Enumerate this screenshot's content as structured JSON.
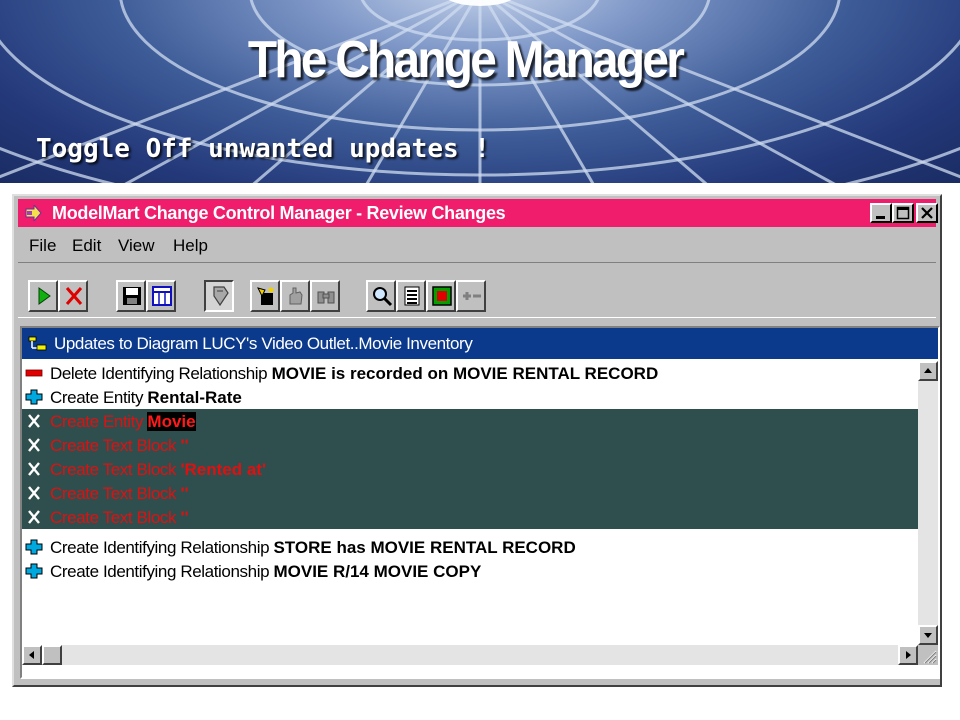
{
  "slide": {
    "title": "The Change Manager",
    "subtitle": "Toggle Off unwanted updates !"
  },
  "window": {
    "title": "ModelMart Change Control Manager - Review Changes",
    "controls": [
      "minimize",
      "maximize",
      "close"
    ]
  },
  "menu": [
    "File",
    "Edit",
    "View",
    "Help"
  ],
  "toolbar": {
    "buttons": [
      {
        "name": "run-button",
        "icon": "green-play-triangle"
      },
      {
        "name": "cancel-button",
        "icon": "red-x"
      },
      {
        "name": "save-button",
        "icon": "floppy-disk"
      },
      {
        "name": "grid-button",
        "icon": "grid"
      },
      {
        "name": "toggle-button",
        "icon": "toggle-pressed",
        "pressed": true
      },
      {
        "name": "select-all-button",
        "icon": "hand-select"
      },
      {
        "name": "filter-button",
        "icon": "hand-gray"
      },
      {
        "name": "find-button",
        "icon": "binoculars"
      },
      {
        "name": "search-button",
        "icon": "magnifier"
      },
      {
        "name": "list-button",
        "icon": "lines"
      },
      {
        "name": "entity-button",
        "icon": "green-box"
      },
      {
        "name": "expand-collapse-button",
        "icon": "plus-minus"
      }
    ]
  },
  "pane": {
    "header": "Updates to Diagram LUCY's Video Outlet..Movie Inventory"
  },
  "changes": [
    {
      "action": "Delete Identifying Relationship",
      "object": "MOVIE is recorded on MOVIE RENTAL RECORD",
      "status": "delete",
      "icon": "minus-icon"
    },
    {
      "action": "Create Entity",
      "object": "Rental-Rate",
      "status": "create",
      "icon": "plus-icon"
    },
    {
      "action": "Create Entity",
      "object": "Movie",
      "status": "off",
      "icon": "toggle-off-x-icon",
      "highlight": true
    },
    {
      "action": "Create Text Block",
      "object": "''",
      "status": "off",
      "icon": "toggle-off-x-icon"
    },
    {
      "action": "Create Text Block",
      "object": "'Rented at'",
      "status": "off",
      "icon": "toggle-off-x-icon"
    },
    {
      "action": "Create Text Block",
      "object": "''",
      "status": "off",
      "icon": "toggle-off-x-icon"
    },
    {
      "action": "Create Text Block",
      "object": "''",
      "status": "off",
      "icon": "toggle-off-x-icon"
    },
    {
      "action": "Create Identifying Relationship",
      "object": "STORE has MOVIE RENTAL RECORD",
      "status": "create",
      "icon": "plus-icon"
    },
    {
      "action": "Create Identifying Relationship",
      "object": "MOVIE R/14 MOVIE COPY",
      "status": "create",
      "icon": "plus-icon"
    }
  ],
  "colors": {
    "titlebar": "#ef1d6b",
    "pane_header": "#0b3a8c",
    "off_row_bg": "#2f4f4f",
    "off_text": "#e01010",
    "plus_icon": "#00a0d0",
    "minus_icon": "#e00000"
  }
}
